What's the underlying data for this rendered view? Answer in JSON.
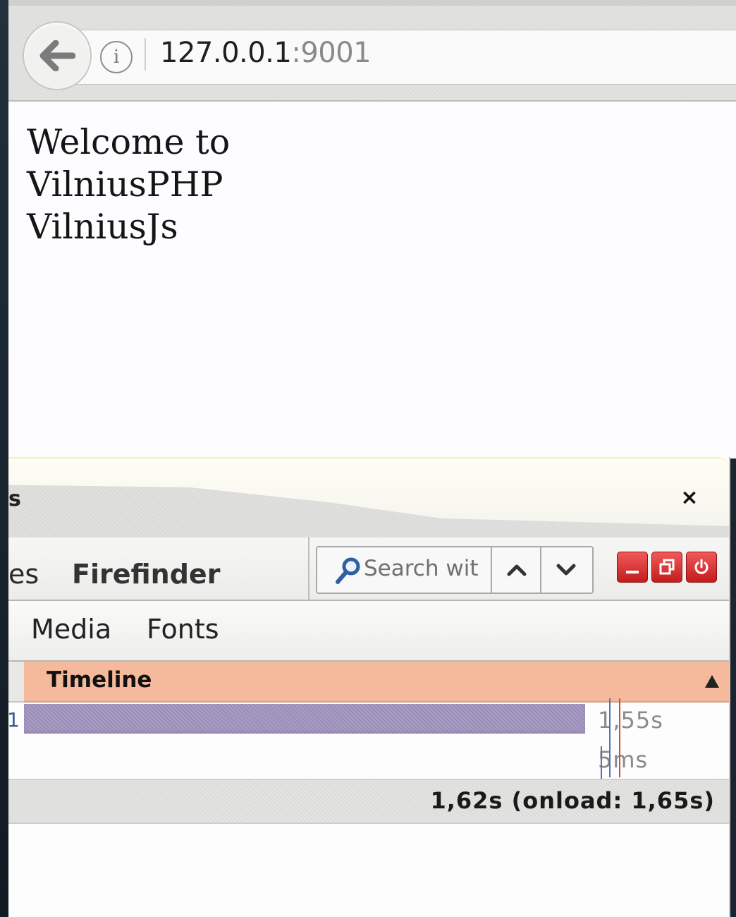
{
  "browser": {
    "url_host": "127.0.0.1",
    "url_port": ":9001"
  },
  "page": {
    "lines": [
      "Welcome to",
      "VilniusPHP",
      "VilniusJs"
    ]
  },
  "devtools": {
    "title_fragment": "s",
    "close_symbol": "×",
    "tabs": {
      "fragment": "es",
      "firefinder": "Firefinder"
    },
    "search": {
      "placeholder": "Search wit"
    },
    "subtabs": [
      "Media",
      "Fonts"
    ],
    "timeline": {
      "header": "Timeline",
      "rows": [
        {
          "left_fragment": "1",
          "bar_fraction": 1.0,
          "time": "1,55s"
        },
        {
          "time": "5ms"
        }
      ],
      "footer": "1,62s (onload: 1,65s)"
    },
    "colors": {
      "timeline_header": "#f5b99c",
      "timeline_bar": "#a89dc3",
      "dom_line": "#5a6cc4",
      "load_line": "#cc4f3a",
      "window_buttons": "#d42a2a"
    },
    "icons": [
      "back-arrow-icon",
      "info-icon",
      "search-icon",
      "chevron-up-icon",
      "chevron-down-icon",
      "minimize-icon",
      "restore-icon",
      "power-icon",
      "sort-ascending-icon",
      "close-icon"
    ]
  }
}
